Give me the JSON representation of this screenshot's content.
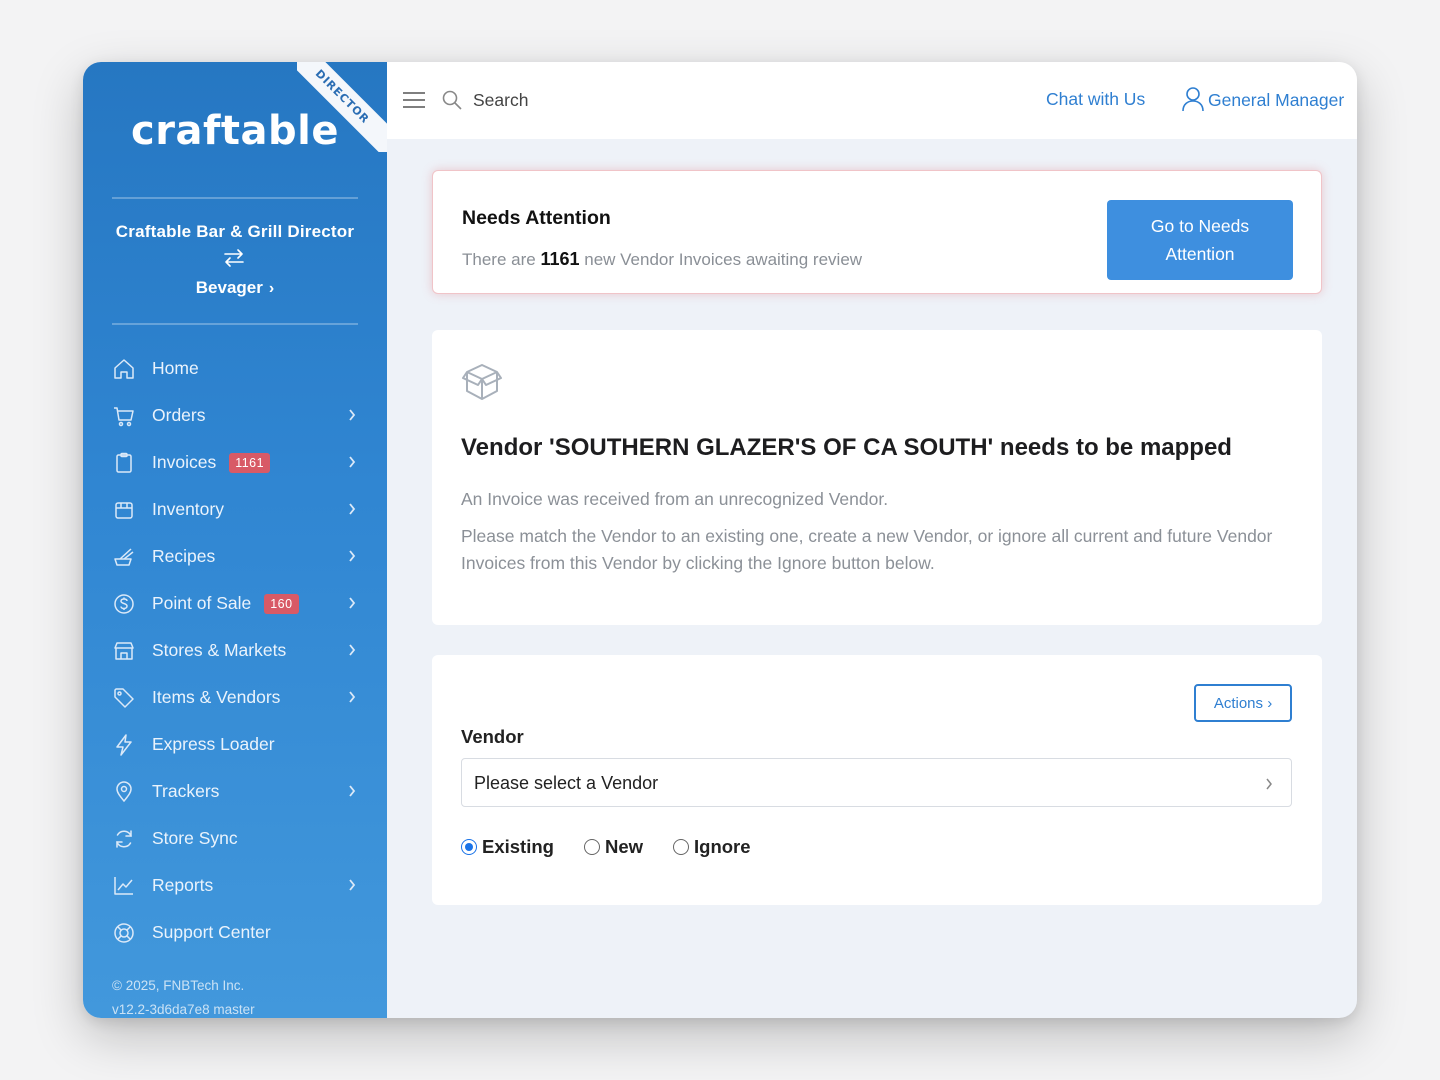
{
  "sidebar": {
    "ribbon": "DIRECTOR",
    "logo": "craftable",
    "org_name": "Craftable Bar & Grill Director",
    "org_sub": "Bevager",
    "items": [
      {
        "label": "Home",
        "icon": "home-icon",
        "has_chevron": false
      },
      {
        "label": "Orders",
        "icon": "cart-icon",
        "has_chevron": true
      },
      {
        "label": "Invoices",
        "icon": "clipboard-icon",
        "badge": "1161",
        "has_chevron": true
      },
      {
        "label": "Inventory",
        "icon": "inventory-icon",
        "has_chevron": true
      },
      {
        "label": "Recipes",
        "icon": "recipes-icon",
        "has_chevron": true
      },
      {
        "label": "Point of Sale",
        "icon": "dollar-icon",
        "badge": "160",
        "has_chevron": true
      },
      {
        "label": "Stores & Markets",
        "icon": "store-icon",
        "has_chevron": true
      },
      {
        "label": "Items & Vendors",
        "icon": "tag-icon",
        "has_chevron": true
      },
      {
        "label": "Express Loader",
        "icon": "lightning-icon",
        "has_chevron": false
      },
      {
        "label": "Trackers",
        "icon": "location-pin-icon",
        "has_chevron": true
      },
      {
        "label": "Store Sync",
        "icon": "sync-icon",
        "has_chevron": false
      },
      {
        "label": "Reports",
        "icon": "chart-icon",
        "has_chevron": true
      },
      {
        "label": "Support Center",
        "icon": "lifebuoy-icon",
        "has_chevron": false
      }
    ],
    "copyright": "© 2025, FNBTech Inc.",
    "version": "v12.2-3d6da7e8 master"
  },
  "topbar": {
    "search_placeholder": "Search",
    "chat": "Chat with Us",
    "user": "General Manager"
  },
  "alert": {
    "title": "Needs Attention",
    "text_prefix": "There are",
    "count": "1161",
    "text_suffix": "new Vendor Invoices awaiting review",
    "button": "Go to Needs Attention"
  },
  "vendor_card": {
    "heading": "Vendor 'SOUTHERN GLAZER'S OF CA SOUTH' needs to be mapped",
    "p1": "An Invoice was received from an unrecognized Vendor.",
    "p2": "Please match the Vendor to an existing one, create a new Vendor, or ignore all current and future Vendor Invoices from this Vendor by clicking the Ignore button below."
  },
  "form": {
    "actions": "Actions",
    "vendor_label": "Vendor",
    "vendor_select": "Please select a Vendor",
    "radios": [
      {
        "label": "Existing",
        "checked": true
      },
      {
        "label": "New",
        "checked": false
      },
      {
        "label": "Ignore",
        "checked": false
      }
    ]
  },
  "colors": {
    "sidebar_top": "#2677c2",
    "sidebar_bottom": "#4298dc",
    "accent": "#2f7fd1",
    "badge": "#d85a66",
    "alert_border": "#f0c4c8"
  }
}
